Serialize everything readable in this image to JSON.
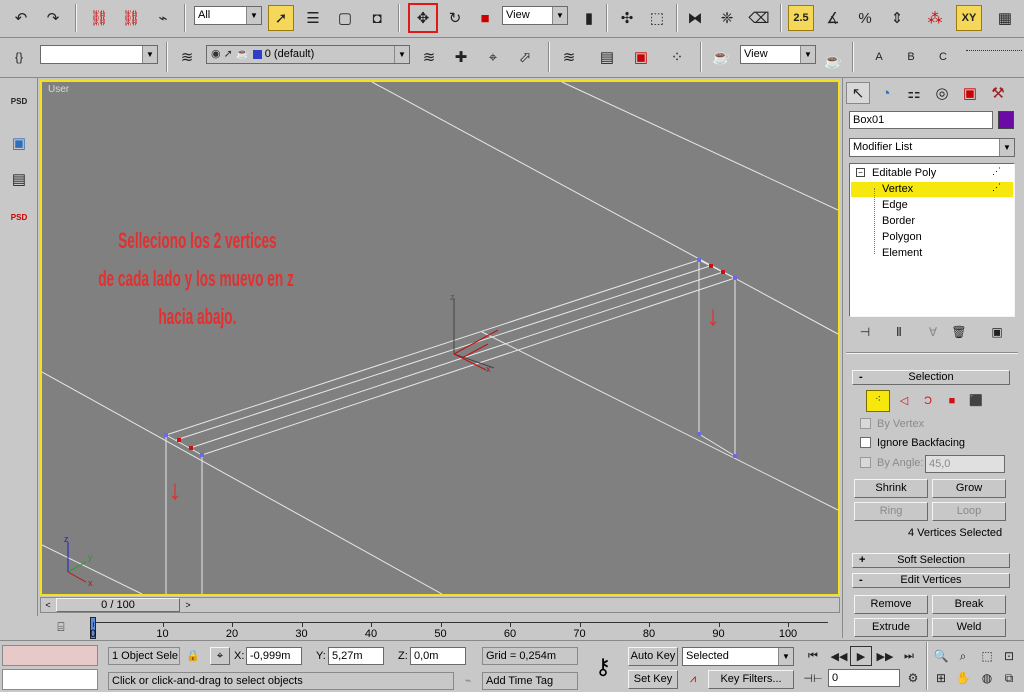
{
  "toolbar": {
    "selection_filter": "All",
    "ref_coord": "View",
    "layer_name": "0 (default)",
    "named_sel_placeholder": "",
    "ref_coord2": "View"
  },
  "viewport": {
    "label": "User",
    "annotation": [
      "Selleciono los 2 vertices",
      "de cada lado y los muevo en z",
      "hacia abajo."
    ],
    "arrow_glyph": "↓",
    "axis_x": "x",
    "axis_y": "y",
    "axis_z": "z"
  },
  "command_panel": {
    "object_name": "Box01",
    "object_color": "#6b0aa6",
    "modifier_list": "Modifier List",
    "stack": [
      {
        "label": "Editable Poly",
        "selected": false,
        "root": true
      },
      {
        "label": "Vertex",
        "selected": true,
        "root": false
      },
      {
        "label": "Edge",
        "selected": false,
        "root": false
      },
      {
        "label": "Border",
        "selected": false,
        "root": false
      },
      {
        "label": "Polygon",
        "selected": false,
        "root": false
      },
      {
        "label": "Element",
        "selected": false,
        "root": false
      }
    ],
    "selection": {
      "title": "Selection",
      "by_vertex": "By Vertex",
      "ignore_backfacing": "Ignore Backfacing",
      "by_angle": "By Angle:",
      "angle_value": "45,0",
      "shrink": "Shrink",
      "grow": "Grow",
      "ring": "Ring",
      "loop": "Loop",
      "status": "4 Vertices Selected"
    },
    "soft_selection": "Soft Selection",
    "edit_vertices": {
      "title": "Edit Vertices",
      "remove": "Remove",
      "break": "Break",
      "extrude": "Extrude",
      "weld": "Weld"
    },
    "rollout_collapse": "-",
    "rollout_expand": "+"
  },
  "timeline": {
    "frame": "0 / 100",
    "ticks": [
      "0",
      "10",
      "20",
      "30",
      "40",
      "50",
      "60",
      "70",
      "80",
      "90",
      "100"
    ]
  },
  "status": {
    "selected_objects": "1 Object Sele",
    "x_label": "X:",
    "x_value": "-0,999m",
    "y_label": "Y:",
    "y_value": "5,27m",
    "z_label": "Z:",
    "z_value": "0,0m",
    "grid": "Grid = 0,254m",
    "prompt": "Click or click-and-drag to select objects",
    "add_time_tag": "Add Time Tag",
    "auto_key": "Auto Key",
    "set_key": "Set Key",
    "key_mode": "Selected",
    "key_filters": "Key Filters...",
    "current_frame": "0"
  }
}
